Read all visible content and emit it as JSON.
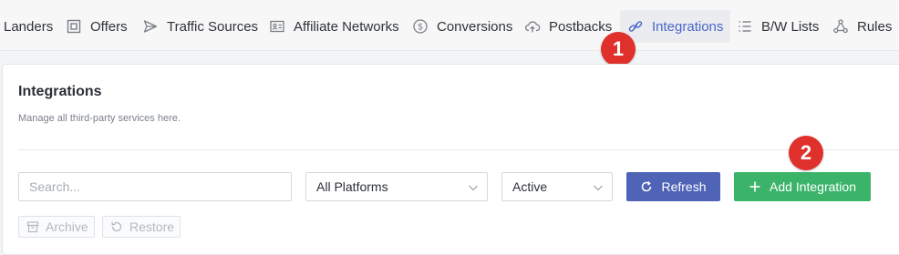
{
  "nav": {
    "items": [
      {
        "label": "Landers",
        "icon": "landers-icon"
      },
      {
        "label": "Offers",
        "icon": "offers-icon"
      },
      {
        "label": "Traffic Sources",
        "icon": "send-icon"
      },
      {
        "label": "Affiliate Networks",
        "icon": "id-card-icon"
      },
      {
        "label": "Conversions",
        "icon": "dollar-circle-icon"
      },
      {
        "label": "Postbacks",
        "icon": "cloud-upload-icon"
      },
      {
        "label": "Integrations",
        "icon": "link-icon"
      },
      {
        "label": "B/W Lists",
        "icon": "list-icon"
      },
      {
        "label": "Rules",
        "icon": "nodes-icon"
      }
    ],
    "active": "Integrations"
  },
  "annotations": {
    "badge1": "1",
    "badge2": "2",
    "color": "#e0302b"
  },
  "panel": {
    "title": "Integrations",
    "subtitle": "Manage all third-party services here."
  },
  "filters": {
    "search_placeholder": "Search...",
    "platform_selected": "All Platforms",
    "status_selected": "Active"
  },
  "buttons": {
    "refresh_label": "Refresh",
    "add_label": "Add Integration",
    "archive_label": "Archive",
    "restore_label": "Restore"
  },
  "colors": {
    "accent": "#4a67c8",
    "refresh": "#4f63b7",
    "add": "#3bb46a"
  }
}
